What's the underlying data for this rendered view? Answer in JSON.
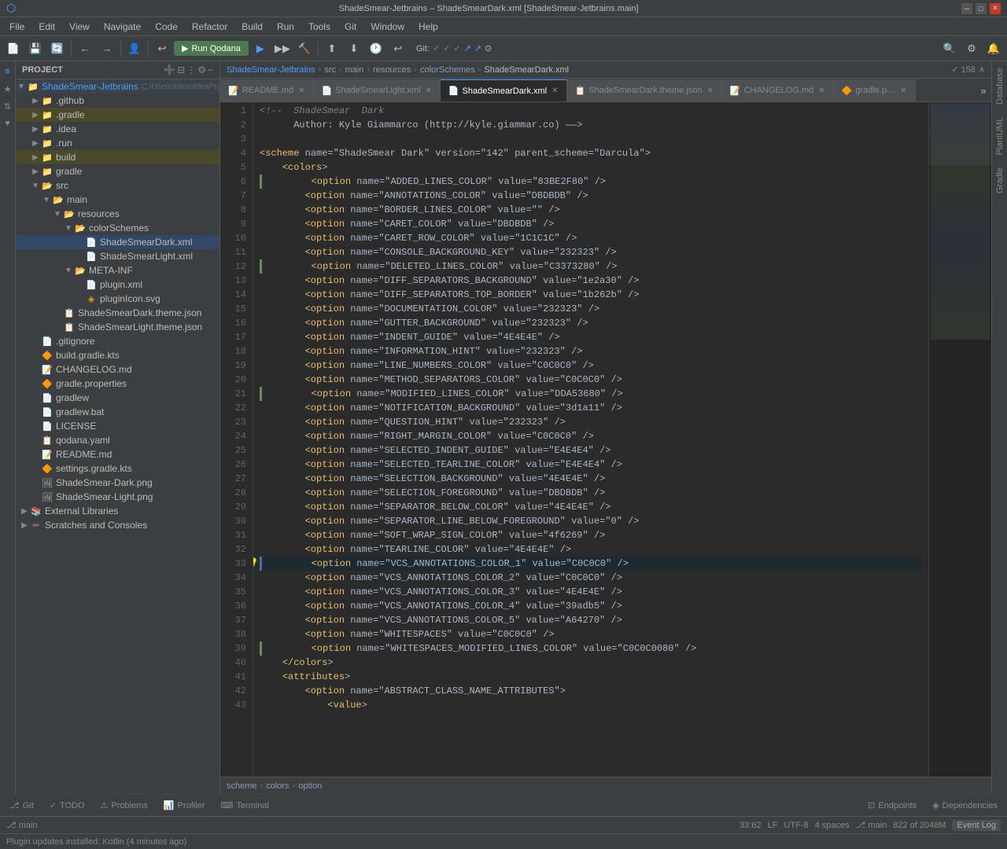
{
  "app": {
    "title": "ShadeSmear-Jetbrains – ShadeSmearDark.xml [ShadeSmear-Jetbrains.main]"
  },
  "titlebar": {
    "title": "ShadeSmear-Jetbrains – ShadeSmearDark.xml [ShadeSmear-Jetbrains.main]",
    "min": "─",
    "max": "□",
    "close": "✕"
  },
  "menu": {
    "items": [
      "File",
      "Edit",
      "View",
      "Navigate",
      "Code",
      "Refactor",
      "Build",
      "Run",
      "Tools",
      "Git",
      "Window",
      "Help"
    ]
  },
  "toolbar": {
    "run_label": "Run Qodana",
    "git_label": "Git:",
    "git_status": "✓ ✓ ✓ ↗ ↗ ⊙"
  },
  "breadcrumb": {
    "parts": [
      "ShadeSmear-Jetbrains",
      "src",
      "main",
      "resources",
      "colorSchemes",
      "ShadeSmearDark.xml"
    ]
  },
  "tabs": [
    {
      "label": "README.md",
      "active": false,
      "modified": false
    },
    {
      "label": "ShadeSmearLight.xml",
      "active": false,
      "modified": false
    },
    {
      "label": "ShadeSmearDark.xml",
      "active": true,
      "modified": false
    },
    {
      "label": "ShadeSmearDark.theme.json",
      "active": false,
      "modified": false
    },
    {
      "label": "CHANGELOG.md",
      "active": false,
      "modified": false
    },
    {
      "label": "gradle.p…",
      "active": false,
      "modified": false
    }
  ],
  "code": {
    "line_count": 158,
    "position": "822 of 2048M",
    "cursor": "33:62",
    "encoding": "UTF-8",
    "indent": "4 spaces",
    "branch": "main",
    "lines": [
      {
        "num": 1,
        "text": "<!--  ShadeSmear  Dark",
        "modified": false,
        "changed": false
      },
      {
        "num": 2,
        "text": "      Author: Kyle Giammarco (http://kyle.giammar.co) ——>",
        "modified": false,
        "changed": false
      },
      {
        "num": 3,
        "text": "",
        "modified": false,
        "changed": false
      },
      {
        "num": 4,
        "text": "<scheme name=\"ShadeSmear Dark\" version=\"142\" parent_scheme=\"Darcula\">",
        "modified": false,
        "changed": false
      },
      {
        "num": 5,
        "text": "    <colors>",
        "modified": false,
        "changed": false
      },
      {
        "num": 6,
        "text": "        <option name=\"ADDED_LINES_COLOR\" value=\"83BE2F80\" />",
        "modified": true,
        "changed": false
      },
      {
        "num": 7,
        "text": "        <option name=\"ANNOTATIONS_COLOR\" value=\"DBDBDB\" />",
        "modified": false,
        "changed": false
      },
      {
        "num": 8,
        "text": "        <option name=\"BORDER_LINES_COLOR\" value=\"\" />",
        "modified": false,
        "changed": false
      },
      {
        "num": 9,
        "text": "        <option name=\"CARET_COLOR\" value=\"DBDBDB\" />",
        "modified": false,
        "changed": false
      },
      {
        "num": 10,
        "text": "        <option name=\"CARET_ROW_COLOR\" value=\"1C1C1C\" />",
        "modified": false,
        "changed": false
      },
      {
        "num": 11,
        "text": "        <option name=\"CONSOLE_BACKGROUND_KEY\" value=\"232323\" />",
        "modified": false,
        "changed": false
      },
      {
        "num": 12,
        "text": "        <option name=\"DELETED_LINES_COLOR\" value=\"C3373280\" />",
        "modified": true,
        "changed": false
      },
      {
        "num": 13,
        "text": "        <option name=\"DIFF_SEPARATORS_BACKGROUND\" value=\"1e2a30\" />",
        "modified": false,
        "changed": false
      },
      {
        "num": 14,
        "text": "        <option name=\"DIFF_SEPARATORS_TOP_BORDER\" value=\"1b262b\" />",
        "modified": false,
        "changed": false
      },
      {
        "num": 15,
        "text": "        <option name=\"DOCUMENTATION_COLOR\" value=\"232323\" />",
        "modified": false,
        "changed": false
      },
      {
        "num": 16,
        "text": "        <option name=\"GUTTER_BACKGROUND\" value=\"232323\" />",
        "modified": false,
        "changed": false
      },
      {
        "num": 17,
        "text": "        <option name=\"INDENT_GUIDE\" value=\"4E4E4E\" />",
        "modified": false,
        "changed": false
      },
      {
        "num": 18,
        "text": "        <option name=\"INFORMATION_HINT\" value=\"232323\" />",
        "modified": false,
        "changed": false
      },
      {
        "num": 19,
        "text": "        <option name=\"LINE_NUMBERS_COLOR\" value=\"C0C0C0\" />",
        "modified": false,
        "changed": false
      },
      {
        "num": 20,
        "text": "        <option name=\"METHOD_SEPARATORS_COLOR\" value=\"C0C0C0\" />",
        "modified": false,
        "changed": false
      },
      {
        "num": 21,
        "text": "        <option name=\"MODIFIED_LINES_COLOR\" value=\"DDA53680\" />",
        "modified": true,
        "changed": false
      },
      {
        "num": 22,
        "text": "        <option name=\"NOTIFICATION_BACKGROUND\" value=\"3d1a11\" />",
        "modified": false,
        "changed": false
      },
      {
        "num": 23,
        "text": "        <option name=\"QUESTION_HINT\" value=\"232323\" />",
        "modified": false,
        "changed": false
      },
      {
        "num": 24,
        "text": "        <option name=\"RIGHT_MARGIN_COLOR\" value=\"C0C0C0\" />",
        "modified": false,
        "changed": false
      },
      {
        "num": 25,
        "text": "        <option name=\"SELECTED_INDENT_GUIDE\" value=\"E4E4E4\" />",
        "modified": false,
        "changed": false
      },
      {
        "num": 26,
        "text": "        <option name=\"SELECTED_TEARLINE_COLOR\" value=\"E4E4E4\" />",
        "modified": false,
        "changed": false
      },
      {
        "num": 27,
        "text": "        <option name=\"SELECTION_BACKGROUND\" value=\"4E4E4E\" />",
        "modified": false,
        "changed": false
      },
      {
        "num": 28,
        "text": "        <option name=\"SELECTION_FOREGROUND\" value=\"DBDBDB\" />",
        "modified": false,
        "changed": false
      },
      {
        "num": 29,
        "text": "        <option name=\"SEPARATOR_BELOW_COLOR\" value=\"4E4E4E\" />",
        "modified": false,
        "changed": false
      },
      {
        "num": 30,
        "text": "        <option name=\"SEPARATOR_LINE_BELOW_FOREGROUND\" value=\"0\" />",
        "modified": false,
        "changed": false
      },
      {
        "num": 31,
        "text": "        <option name=\"SOFT_WRAP_SIGN_COLOR\" value=\"4f6269\" />",
        "modified": false,
        "changed": false
      },
      {
        "num": 32,
        "text": "        <option name=\"TEARLINE_COLOR\" value=\"4E4E4E\" />",
        "modified": false,
        "changed": false
      },
      {
        "num": 33,
        "text": "        <option name=\"VCS_ANNOTATIONS_COLOR_1\" value=\"C0C0C0\" />",
        "modified": false,
        "changed": true,
        "has_icon": true
      },
      {
        "num": 34,
        "text": "        <option name=\"VCS_ANNOTATIONS_COLOR_2\" value=\"C0C0C0\" />",
        "modified": false,
        "changed": false
      },
      {
        "num": 35,
        "text": "        <option name=\"VCS_ANNOTATIONS_COLOR_3\" value=\"4E4E4E\" />",
        "modified": false,
        "changed": false
      },
      {
        "num": 36,
        "text": "        <option name=\"VCS_ANNOTATIONS_COLOR_4\" value=\"39adb5\" />",
        "modified": false,
        "changed": false
      },
      {
        "num": 37,
        "text": "        <option name=\"VCS_ANNOTATIONS_COLOR_5\" value=\"A64270\" />",
        "modified": false,
        "changed": false
      },
      {
        "num": 38,
        "text": "        <option name=\"WHITESPACES\" value=\"C0C0C0\" />",
        "modified": false,
        "changed": false
      },
      {
        "num": 39,
        "text": "        <option name=\"WHITESPACES_MODIFIED_LINES_COLOR\" value=\"C0C0C0080\" />",
        "modified": true,
        "changed": false
      },
      {
        "num": 40,
        "text": "    </colors>",
        "modified": false,
        "changed": false
      },
      {
        "num": 41,
        "text": "    <attributes>",
        "modified": false,
        "changed": false
      },
      {
        "num": 42,
        "text": "        <option name=\"ABSTRACT_CLASS_NAME_ATTRIBUTES\">",
        "modified": false,
        "changed": false
      },
      {
        "num": 43,
        "text": "            <value>",
        "modified": false,
        "changed": false
      }
    ]
  },
  "tree": {
    "project_label": "Project",
    "root": "ShadeSmear-Jetbrains",
    "root_path": "C:\\Users\\hiros\\IdeaProjects\\Shad...",
    "items": [
      {
        "label": ".github",
        "type": "folder",
        "level": 1,
        "expanded": false
      },
      {
        "label": ".gradle",
        "type": "folder",
        "level": 1,
        "expanded": false,
        "highlighted": true
      },
      {
        "label": ".idea",
        "type": "folder",
        "level": 1,
        "expanded": false
      },
      {
        "label": ".run",
        "type": "folder",
        "level": 1,
        "expanded": false
      },
      {
        "label": "build",
        "type": "folder",
        "level": 1,
        "expanded": false,
        "highlighted": true
      },
      {
        "label": "gradle",
        "type": "folder",
        "level": 1,
        "expanded": false
      },
      {
        "label": "src",
        "type": "folder",
        "level": 1,
        "expanded": true
      },
      {
        "label": "main",
        "type": "folder",
        "level": 2,
        "expanded": true
      },
      {
        "label": "resources",
        "type": "folder",
        "level": 3,
        "expanded": true
      },
      {
        "label": "colorSchemes",
        "type": "folder",
        "level": 4,
        "expanded": true
      },
      {
        "label": "ShadeSmearDark.xml",
        "type": "xml",
        "level": 5,
        "expanded": false,
        "active": true
      },
      {
        "label": "ShadeSmearLight.xml",
        "type": "xml",
        "level": 5,
        "expanded": false
      },
      {
        "label": "META-INF",
        "type": "folder",
        "level": 4,
        "expanded": true
      },
      {
        "label": "plugin.xml",
        "type": "xml",
        "level": 5,
        "expanded": false
      },
      {
        "label": "pluginIcon.svg",
        "type": "svg",
        "level": 5,
        "expanded": false
      },
      {
        "label": "ShadeSmearDark.theme.json",
        "type": "json",
        "level": 3,
        "expanded": false
      },
      {
        "label": "ShadeSmearLight.theme.json",
        "type": "json",
        "level": 3,
        "expanded": false
      },
      {
        "label": ".gitignore",
        "type": "gitignore",
        "level": 1,
        "expanded": false
      },
      {
        "label": "build.gradle.kts",
        "type": "kt",
        "level": 1,
        "expanded": false
      },
      {
        "label": "CHANGELOG.md",
        "type": "md",
        "level": 1,
        "expanded": false
      },
      {
        "label": "gradle.properties",
        "type": "properties",
        "level": 1,
        "expanded": false
      },
      {
        "label": "gradlew",
        "type": "file",
        "level": 1,
        "expanded": false
      },
      {
        "label": "gradlew.bat",
        "type": "bat",
        "level": 1,
        "expanded": false
      },
      {
        "label": "LICENSE",
        "type": "file",
        "level": 1,
        "expanded": false
      },
      {
        "label": "qodana.yaml",
        "type": "yaml",
        "level": 1,
        "expanded": false
      },
      {
        "label": "README.md",
        "type": "md",
        "level": 1,
        "expanded": false
      },
      {
        "label": "settings.gradle.kts",
        "type": "kt",
        "level": 1,
        "expanded": false
      },
      {
        "label": "ShadeSmear-Dark.png",
        "type": "png",
        "level": 1,
        "expanded": false
      },
      {
        "label": "ShadeSmear-Light.png",
        "type": "png",
        "level": 1,
        "expanded": false
      },
      {
        "label": "External Libraries",
        "type": "folder-ext",
        "level": 1,
        "expanded": false
      },
      {
        "label": "Scratches and Consoles",
        "type": "folder-sc",
        "level": 1,
        "expanded": false
      }
    ]
  },
  "statusbar": {
    "git_branch": "main",
    "cursor": "33:62",
    "line_ending": "LF",
    "encoding": "UTF-8",
    "indent": "4 spaces",
    "position": "822 of 2048M",
    "event_log": "Event Log"
  },
  "bottom_tabs": [
    {
      "label": "Git",
      "icon": "⎇",
      "active": false
    },
    {
      "label": "TODO",
      "icon": "✓",
      "active": false
    },
    {
      "label": "Problems",
      "icon": "⚠",
      "active": false
    },
    {
      "label": "Profiler",
      "icon": "📊",
      "active": false
    },
    {
      "label": "Terminal",
      "icon": "⌨",
      "active": false
    }
  ],
  "bottom_right_tabs": [
    {
      "label": "Endpoints",
      "active": false
    },
    {
      "label": "Dependencies",
      "active": false
    }
  ],
  "right_tabs": [
    "Database",
    "PlantUML",
    "Gradle"
  ],
  "notification": {
    "text": "Plugin updates installed: Kotlin (4 minutes ago)"
  },
  "breadcrumb_bottom": {
    "parts": [
      "scheme",
      "colors",
      "option"
    ]
  },
  "icons": {
    "folder": "📁",
    "folder_open": "📂",
    "xml_file": "📄",
    "json_file": "📋",
    "kt_file": "🔶",
    "md_file": "📝",
    "arrow_right": "▶",
    "arrow_down": "▼",
    "search": "🔍",
    "settings": "⚙",
    "close": "✕",
    "git": "⎇",
    "warning": "⚠",
    "check": "✓",
    "bulb": "💡"
  }
}
